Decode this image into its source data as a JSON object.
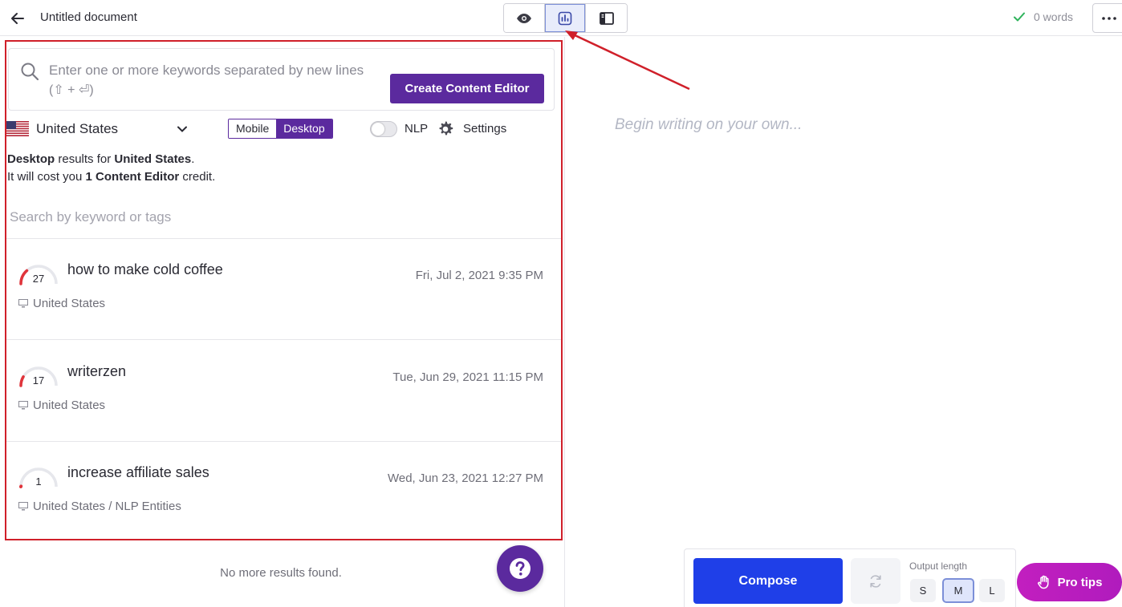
{
  "header": {
    "back_label": "Back",
    "doc_title": "Untitled document",
    "view_buttons": [
      "preview-eye-icon",
      "content-editor-icon",
      "sidebar-layout-icon"
    ],
    "active_view": "content-editor-icon",
    "word_count": "0 words",
    "saved_color": "#2fb35c"
  },
  "search": {
    "placeholder": "Enter one or more keywords separated by new lines",
    "hint": "(⇧ + ⏎)",
    "create_label": "Create Content Editor"
  },
  "options": {
    "country": "United States",
    "device_mobile": "Mobile",
    "device_desktop": "Desktop",
    "selected_device": "Desktop",
    "nlp_label": "NLP",
    "nlp_enabled": false,
    "settings_label": "Settings"
  },
  "info": {
    "device": "Desktop",
    "results_for": "results for",
    "country": "United States",
    "period": ".",
    "cost_pre": "It will cost you",
    "cost_amount": "1 Content Editor",
    "cost_post": "credit."
  },
  "filter": {
    "placeholder": "Search by keyword or tags"
  },
  "results": [
    {
      "score": "27",
      "score_value": 27,
      "title": "how to make cold coffee",
      "date": "Fri, Jul 2, 2021 9:35 PM",
      "meta": "United States"
    },
    {
      "score": "17",
      "score_value": 17,
      "title": "writerzen",
      "date": "Tue, Jun 29, 2021 11:15 PM",
      "meta": "United States"
    },
    {
      "score": "1",
      "score_value": 1,
      "title": "increase affiliate sales",
      "date": "Wed, Jun 23, 2021 12:27 PM",
      "meta": "United States / NLP Entities"
    }
  ],
  "no_more": "No more results found.",
  "editor": {
    "placeholder": "Begin writing on your own..."
  },
  "compose": {
    "compose_label": "Compose",
    "output_length_label": "Output length",
    "lengths": [
      "S",
      "M",
      "L"
    ],
    "selected_length": "M"
  },
  "pro_tips_label": "Pro tips",
  "colors": {
    "brand_purple": "#5b2a9e",
    "compose_blue": "#1f3fe8",
    "highlight_red": "#d0202a",
    "pro_tips_magenta": "#c21fbf"
  }
}
